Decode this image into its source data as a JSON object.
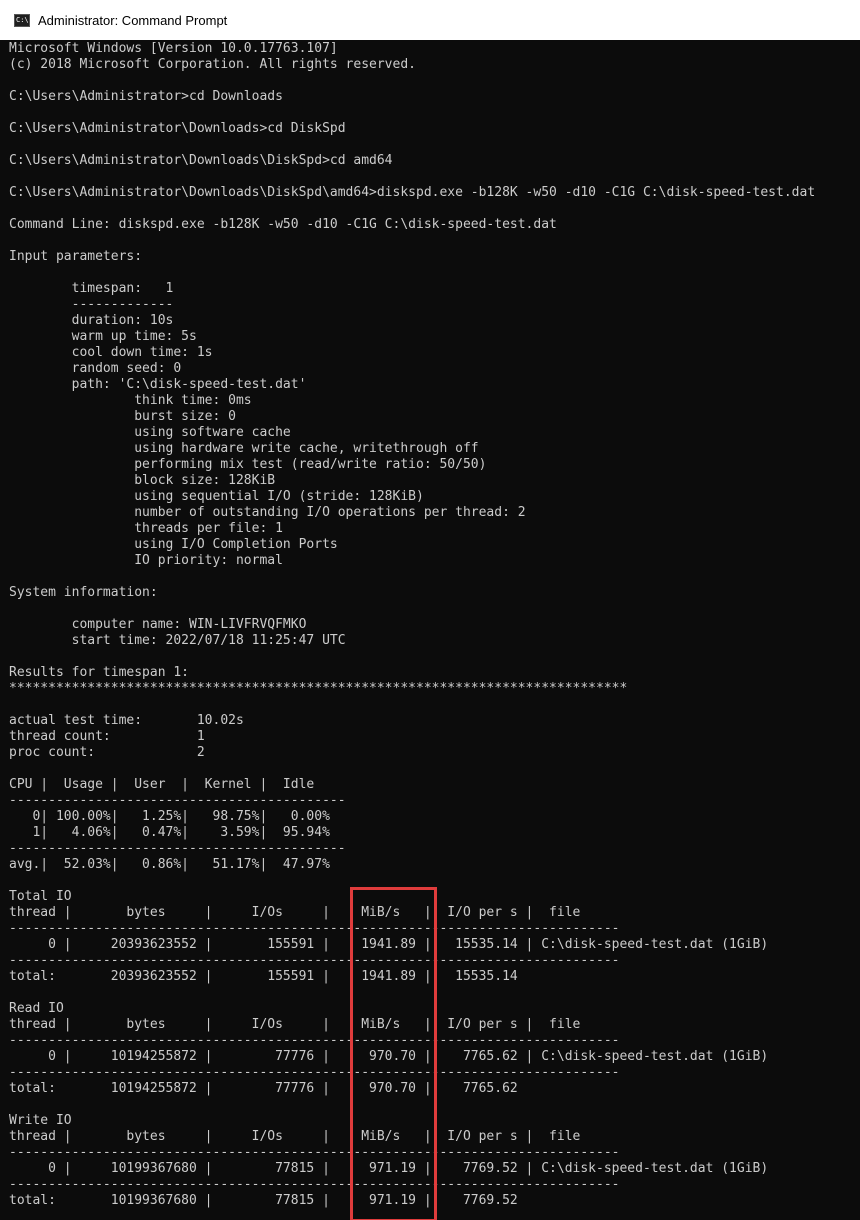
{
  "window": {
    "title": "Administrator: Command Prompt",
    "icon": "cmd-icon",
    "icon_text": "C:\\"
  },
  "console_lines": [
    "Microsoft Windows [Version 10.0.17763.107]",
    "(c) 2018 Microsoft Corporation. All rights reserved.",
    "",
    "C:\\Users\\Administrator>cd Downloads",
    "",
    "C:\\Users\\Administrator\\Downloads>cd DiskSpd",
    "",
    "C:\\Users\\Administrator\\Downloads\\DiskSpd>cd amd64",
    "",
    "C:\\Users\\Administrator\\Downloads\\DiskSpd\\amd64>diskspd.exe -b128K -w50 -d10 -C1G C:\\disk-speed-test.dat",
    "",
    "Command Line: diskspd.exe -b128K -w50 -d10 -C1G C:\\disk-speed-test.dat",
    "",
    "Input parameters:",
    "",
    "        timespan:   1",
    "        -------------",
    "        duration: 10s",
    "        warm up time: 5s",
    "        cool down time: 1s",
    "        random seed: 0",
    "        path: 'C:\\disk-speed-test.dat'",
    "                think time: 0ms",
    "                burst size: 0",
    "                using software cache",
    "                using hardware write cache, writethrough off",
    "                performing mix test (read/write ratio: 50/50)",
    "                block size: 128KiB",
    "                using sequential I/O (stride: 128KiB)",
    "                number of outstanding I/O operations per thread: 2",
    "                threads per file: 1",
    "                using I/O Completion Ports",
    "                IO priority: normal",
    "",
    "System information:",
    "",
    "        computer name: WIN-LIVFRVQFMKO",
    "        start time: 2022/07/18 11:25:47 UTC",
    "",
    "Results for timespan 1:",
    "*******************************************************************************",
    "",
    "actual test time:       10.02s",
    "thread count:           1",
    "proc count:             2",
    "",
    "CPU |  Usage |  User  |  Kernel |  Idle",
    "-------------------------------------------",
    "   0| 100.00%|   1.25%|   98.75%|   0.00%",
    "   1|   4.06%|   0.47%|    3.59%|  95.94%",
    "-------------------------------------------",
    "avg.|  52.03%|   0.86%|   51.17%|  47.97%",
    "",
    "Total IO",
    "thread |       bytes     |     I/Os     |    MiB/s   |  I/O per s |  file",
    "------------------------------------------------------------------------------",
    "     0 |     20393623552 |       155591 |    1941.89 |   15535.14 | C:\\disk-speed-test.dat (1GiB)",
    "------------------------------------------------------------------------------",
    "total:       20393623552 |       155591 |    1941.89 |   15535.14",
    "",
    "Read IO",
    "thread |       bytes     |     I/Os     |    MiB/s   |  I/O per s |  file",
    "------------------------------------------------------------------------------",
    "     0 |     10194255872 |        77776 |     970.70 |    7765.62 | C:\\disk-speed-test.dat (1GiB)",
    "------------------------------------------------------------------------------",
    "total:       10194255872 |        77776 |     970.70 |    7765.62",
    "",
    "Write IO",
    "thread |       bytes     |     I/Os     |    MiB/s   |  I/O per s |  file",
    "------------------------------------------------------------------------------",
    "     0 |     10199367680 |        77815 |     971.19 |    7769.52 | C:\\disk-speed-test.dat (1GiB)",
    "------------------------------------------------------------------------------",
    "total:       10199367680 |        77815 |     971.19 |    7769.52"
  ],
  "colors": {
    "console_background": "#0c0c0c",
    "console_text": "#cccccc",
    "titlebar_background": "#ffffff",
    "highlight_border": "#e03c3c"
  }
}
